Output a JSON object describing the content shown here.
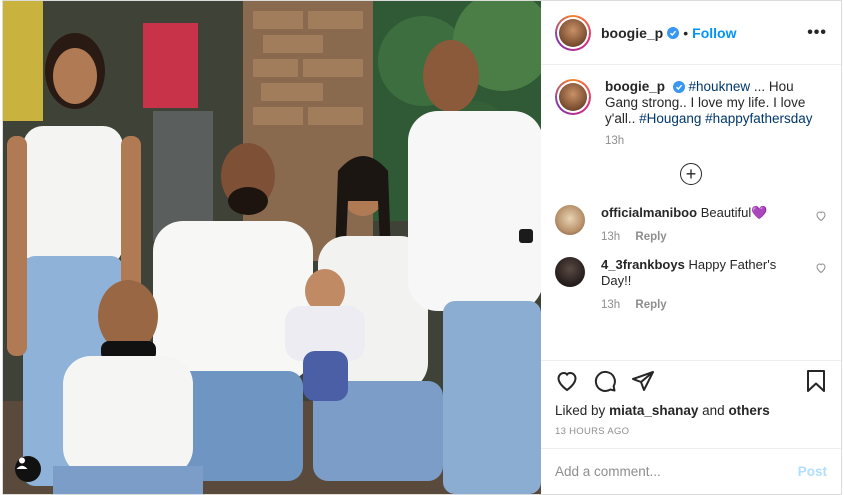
{
  "post": {
    "author": "boogie_p",
    "verified": true,
    "dot": "•",
    "follow_label": "Follow",
    "more_label": "•••",
    "caption": {
      "author": "boogie_p",
      "prefix": "#houknew",
      "text": " ... Hou Gang strong.. I love my life. I love y'all.. ",
      "tag1": "#Hougang",
      "tag2": "#happyfathersday"
    },
    "caption_time": "13h",
    "load_more_icon": "+",
    "comments": [
      {
        "user": "officialmaniboo",
        "text": "Beautiful💜",
        "time": "13h",
        "reply": "Reply"
      },
      {
        "user": "4_3frankboys",
        "text": "Happy Father's Day!!",
        "time": "13h",
        "reply": "Reply"
      }
    ],
    "likes": {
      "prefix": "Liked by",
      "user": "miata_shanay",
      "suffix": "and",
      "others": "others"
    },
    "timestamp": "13 HOURS AGO",
    "add_comment_placeholder": "Add a comment...",
    "post_label": "Post"
  },
  "colors": {
    "accent": "#0095f6",
    "verified": "#3897f0",
    "muted": "#8e8e8e",
    "post_disabled": "#b2dffc"
  },
  "icons": [
    "user-tag-icon",
    "verified-icon",
    "more-icon",
    "plus-circle-icon",
    "heart-icon",
    "comment-icon",
    "share-icon",
    "bookmark-icon"
  ]
}
